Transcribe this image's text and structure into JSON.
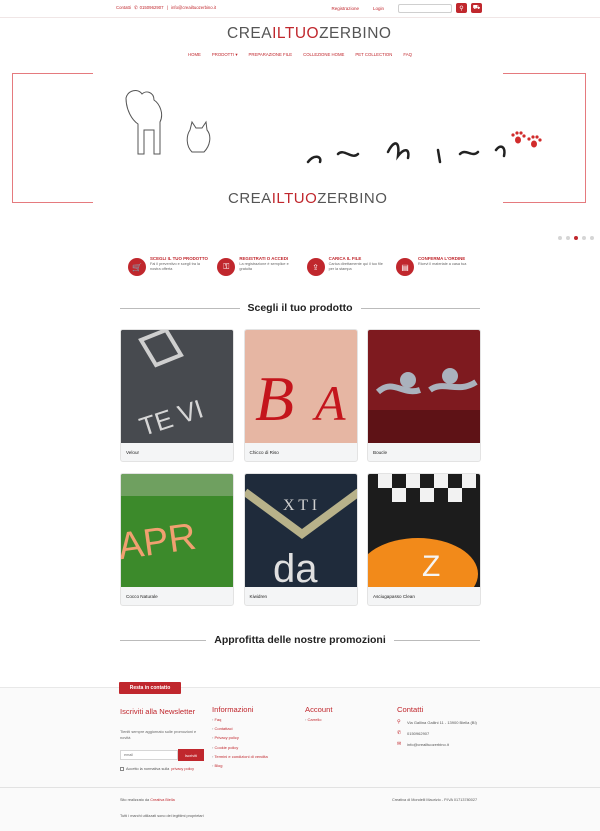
{
  "topbar": {
    "contacts": "Contatti",
    "phone": "0150962907",
    "email": "info@creailtuozerbino.it",
    "register": "Registrazione",
    "login": "Login",
    "search_placeholder": ""
  },
  "logo": {
    "part1": "CREA",
    "part2": "ILTUO",
    "part3": "ZERBINO"
  },
  "nav": [
    "HOME",
    "PRODOTTI ▾",
    "PREPARAZIONE FILE",
    "COLLEZIONE HOME",
    "PET COLLECTION",
    "FAQ"
  ],
  "steps": [
    {
      "title": "SCEGLI IL TUO PRODOTTO",
      "desc": "Fai il preventivo e scegli tra la nostra offerta",
      "icon": "cart-icon"
    },
    {
      "title": "REGISTRATI O ACCEDI",
      "desc": "La registrazione è semplice e gratuita",
      "icon": "key-icon"
    },
    {
      "title": "CARICA IL FILE",
      "desc": "Carica direttamente qui il tuo file per la stampa",
      "icon": "upload-icon"
    },
    {
      "title": "CONFERMA L'ORDINE",
      "desc": "Ricevi il materiale a casa tua",
      "icon": "document-icon"
    }
  ],
  "sections": {
    "products_title": "Scegli il tuo prodotto",
    "promo_title": "Approfitta delle nostre promozioni"
  },
  "products": [
    {
      "name": "Velour",
      "bg": "#4a4d52"
    },
    {
      "name": "Chicco di Riso",
      "bg": "#e3b2a0"
    },
    {
      "name": "Boucle",
      "bg": "#7c1a1e"
    },
    {
      "name": "Cocco Naturale",
      "bg": "#3d8a2c"
    },
    {
      "name": "Kiwidren",
      "bg": "#1e2a3a"
    },
    {
      "name": "Asciugapasso Clean",
      "bg": "#202020"
    }
  ],
  "footer": {
    "tag": "Resta in contatto",
    "newsletter_title": "Iscriviti alla Newsletter",
    "newsletter_text": "Tieniti sempre aggiornato sulle promozioni e novità",
    "email_placeholder": "email",
    "subscribe": "Iscriviti",
    "privacy_accept": "Accetto la normativa sulla",
    "privacy_link": "privacy policy",
    "info_title": "Informazioni",
    "info_links": [
      "Faq",
      "Contattaci",
      "Privacy policy",
      "Cookie policy",
      "Termini e condizioni di vendita",
      "Blog"
    ],
    "account_title": "Account",
    "account_links": [
      "Carrello"
    ],
    "contacts_title": "Contatti",
    "address": "Via Gallina Gallini 11 - 13900 Biella (BI)",
    "phone": "0150962907",
    "email": "info@creailtuozerbino.it",
    "made_by": "Sito realizzato da",
    "made_by_link": "Creativa Biella",
    "company": "Creativa di Mondelli Maurizio - P.IVA 01713780027",
    "rights": "Tutti i marchi utilizzati sono dei legittimi proprietari"
  }
}
